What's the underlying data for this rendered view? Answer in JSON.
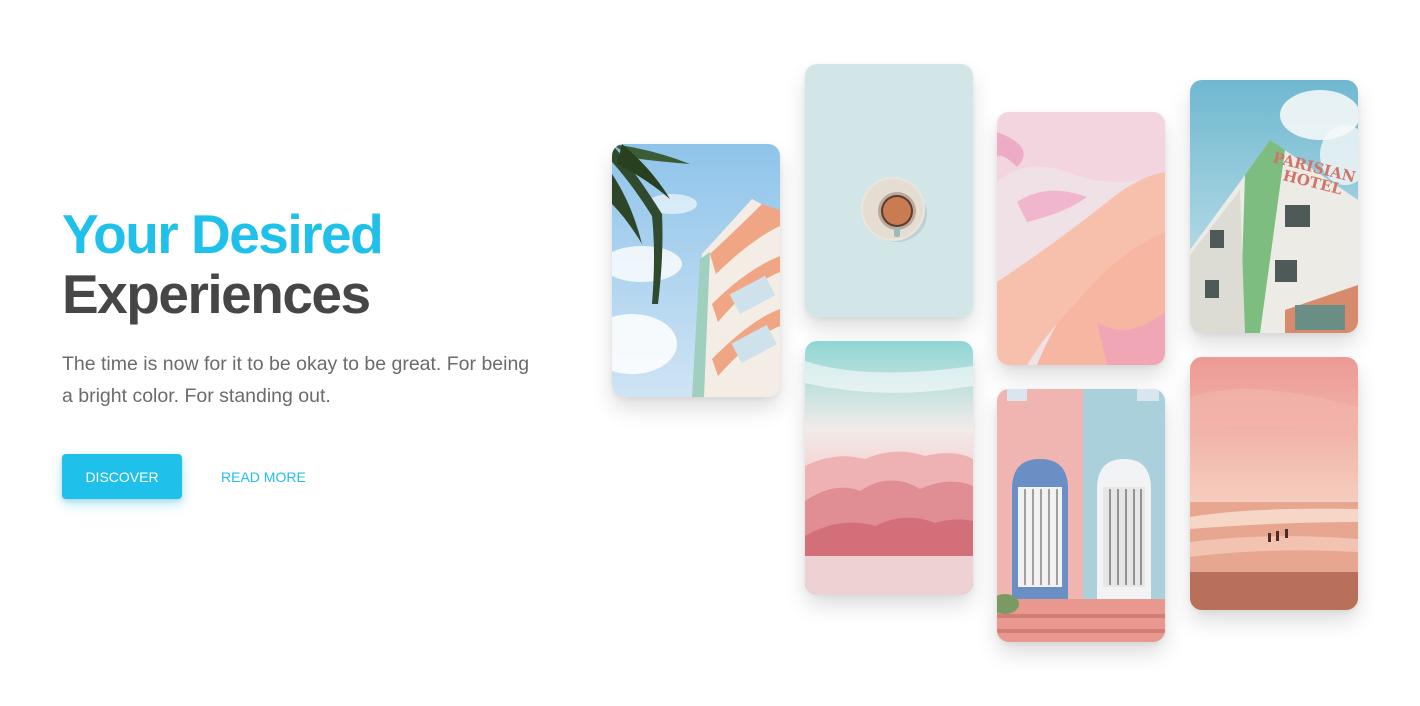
{
  "hero": {
    "title_line1": "Your Desired",
    "title_line2": "Experiences",
    "subtitle": "The time is now for it to be okay to be great. For being a bright color. For standing out.",
    "primary_button": "DISCOVER",
    "secondary_button": "READ MORE"
  },
  "gallery": {
    "items": [
      {
        "name": "art-deco-building-photo"
      },
      {
        "name": "coffee-cup-photo"
      },
      {
        "name": "pink-mountains-photo"
      },
      {
        "name": "pink-marble-photo"
      },
      {
        "name": "colorful-doors-photo"
      },
      {
        "name": "parisian-hotel-photo",
        "sign_text": "PARISIAN HOTEL"
      },
      {
        "name": "pink-beach-photo"
      }
    ]
  },
  "colors": {
    "accent": "#1fc0ea",
    "heading_dark": "#464646",
    "body_text": "#6b6b6b"
  }
}
